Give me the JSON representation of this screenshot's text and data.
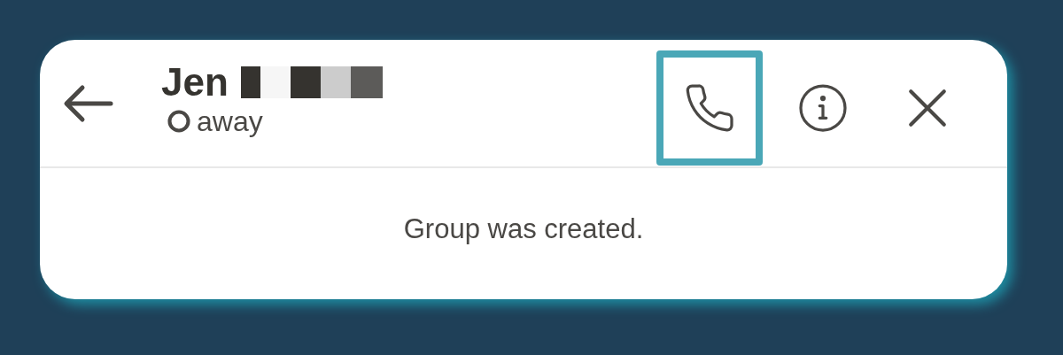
{
  "header": {
    "name": "Jen",
    "name_redacted": true,
    "status": {
      "kind": "away",
      "label": "away"
    },
    "actions": [
      {
        "kind": "call",
        "highlighted": true
      },
      {
        "kind": "info",
        "highlighted": false
      },
      {
        "kind": "close",
        "highlighted": false
      }
    ]
  },
  "messages": [
    {
      "kind": "system",
      "text": "Group was created."
    }
  ]
}
